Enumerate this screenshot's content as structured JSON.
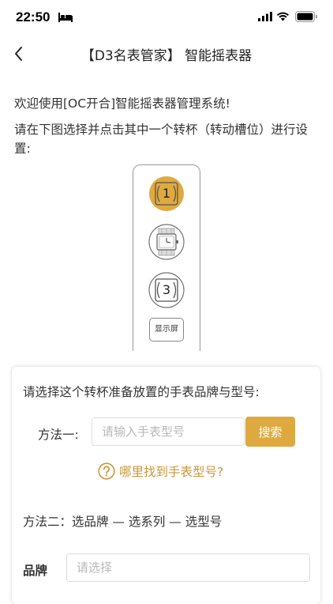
{
  "status_bar": {
    "time": "22:50",
    "icons": [
      "bed-icon",
      "signal-icon",
      "wifi-icon",
      "battery-icon"
    ]
  },
  "nav": {
    "title": "【D3名表管家】 智能摇表器",
    "back_icon": "chevron-left-icon"
  },
  "intro": {
    "welcome": "欢迎使用[OC开合]智能摇表器管理系统!",
    "instruction": "请在下图选择并点击其中一个转杯（转动槽位）进行设置:"
  },
  "winder": {
    "slots": [
      {
        "label": "1",
        "selected": true
      },
      {
        "label": "",
        "has_watch": true
      },
      {
        "label": "3",
        "selected": false
      }
    ],
    "display_label": "显示屏"
  },
  "card": {
    "title": "请选择这个转杯准备放置的手表品牌与型号:",
    "method1_label": "方法一:",
    "model_input_placeholder": "请输入手表型号",
    "search_label": "搜索",
    "help_link": "哪里找到手表型号?",
    "method2": "方法二：选品牌 — 选系列 — 选型号",
    "brand_label": "品牌",
    "brand_placeholder": "请选择"
  },
  "colors": {
    "accent": "#deaa40",
    "link": "#c8973a",
    "slot_selected": "#dfaa3f"
  }
}
